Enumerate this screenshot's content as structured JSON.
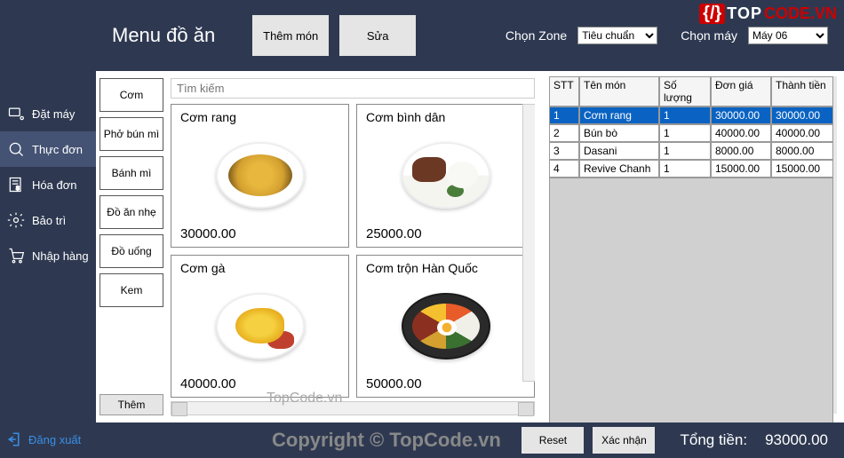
{
  "watermark": {
    "brace": "{/}",
    "t1": "TOP",
    "t2": "CODE.VN"
  },
  "header": {
    "title": "Menu đồ ăn",
    "addBtn": "Thêm món",
    "editBtn": "Sửa",
    "zoneLabel": "Chọn Zone",
    "zoneValue": "Tiêu chuẩn",
    "machineLabel": "Chọn máy",
    "machineValue": "Máy 06"
  },
  "sidebar": {
    "items": [
      {
        "label": "Đặt máy",
        "active": false
      },
      {
        "label": "Thực đơn",
        "active": true
      },
      {
        "label": "Hóa đơn",
        "active": false
      },
      {
        "label": "Bảo trì",
        "active": false
      },
      {
        "label": "Nhập hàng",
        "active": false
      }
    ],
    "logout": "Đăng xuất"
  },
  "categories": [
    "Cơm",
    "Phở bún mì",
    "Bánh mì",
    "Đồ ăn nhẹ",
    "Đồ uống",
    "Kem"
  ],
  "catAdd": "Thêm",
  "searchPlaceholder": "Tìm kiếm",
  "menuItems": [
    {
      "name": "Cơm rang",
      "price": "30000.00",
      "cls": "fried-rice"
    },
    {
      "name": "Cơm bình dân",
      "price": "25000.00",
      "cls": "com-binhdan"
    },
    {
      "name": "Cơm gà",
      "price": "40000.00",
      "cls": "com-ga"
    },
    {
      "name": "Cơm trộn Hàn Quốc",
      "price": "50000.00",
      "cls": "bibimbap"
    }
  ],
  "order": {
    "headers": [
      "STT",
      "Tên món",
      "Số lượng",
      "Đơn giá",
      "Thành tiền"
    ],
    "rows": [
      {
        "stt": "1",
        "name": "Cơm rang",
        "qty": "1",
        "price": "30000.00",
        "total": "30000.00",
        "sel": true
      },
      {
        "stt": "2",
        "name": "Bún bò",
        "qty": "1",
        "price": "40000.00",
        "total": "40000.00"
      },
      {
        "stt": "3",
        "name": "Dasani",
        "qty": "1",
        "price": "8000.00",
        "total": "8000.00"
      },
      {
        "stt": "4",
        "name": "Revive Chanh",
        "qty": "1",
        "price": "15000.00",
        "total": "15000.00"
      }
    ]
  },
  "footer": {
    "reset": "Reset",
    "confirm": "Xác nhận",
    "totalLabel": "Tổng tiền:",
    "totalValue": "93000.00",
    "watermark": "Copyright © TopCode.vn",
    "wm2": "TopCode.vn"
  }
}
